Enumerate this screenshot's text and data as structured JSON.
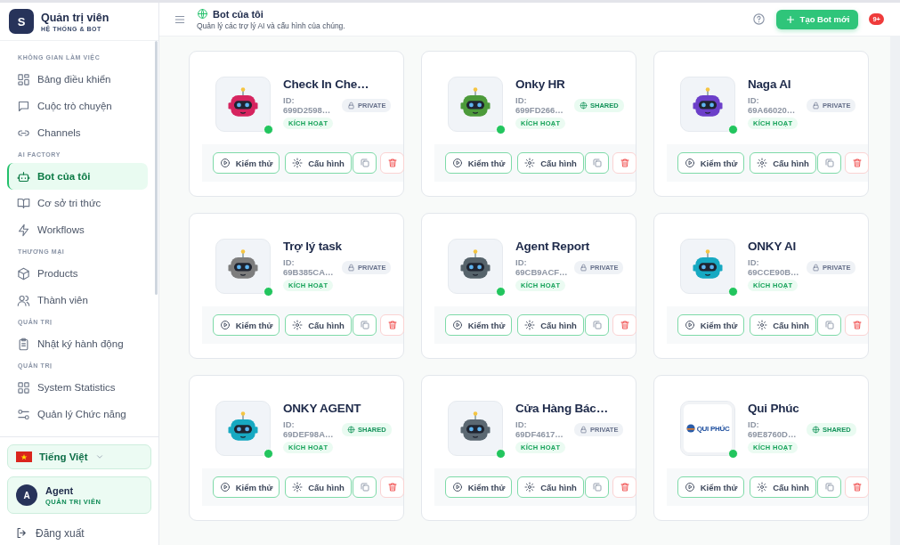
{
  "brand": {
    "logo_letter": "S",
    "title": "Quản trị viên",
    "subtitle": "HỆ THỐNG & BOT"
  },
  "sidebar": {
    "sections": [
      {
        "heading": "KHÔNG GIAN LÀM VIỆC",
        "items": [
          {
            "label": "Bảng điều khiển",
            "selected": false
          },
          {
            "label": "Cuộc trò chuyện",
            "selected": false
          },
          {
            "label": "Channels",
            "selected": false
          }
        ]
      },
      {
        "heading": "AI FACTORY",
        "items": [
          {
            "label": "Bot của tôi",
            "selected": true
          },
          {
            "label": "Cơ sở tri thức",
            "selected": false
          },
          {
            "label": "Workflows",
            "selected": false
          }
        ]
      },
      {
        "heading": "THƯƠNG MẠI",
        "items": [
          {
            "label": "Products",
            "selected": false
          },
          {
            "label": "Thành viên",
            "selected": false
          }
        ]
      },
      {
        "heading": "QUẢN TRỊ",
        "items": [
          {
            "label": "Nhật ký hành động",
            "selected": false
          }
        ]
      },
      {
        "heading": "QUẢN TRỊ",
        "items": [
          {
            "label": "System Statistics",
            "selected": false
          },
          {
            "label": "Quản lý Chức năng",
            "selected": false
          }
        ]
      }
    ],
    "language": "Tiếng Việt",
    "user": {
      "avatar_letter": "A",
      "name": "Agent",
      "role": "QUẢN TRỊ VIÊN"
    },
    "logout": "Đăng xuất"
  },
  "header": {
    "title": "Bot của tôi",
    "subtitle": "Quản lý các trợ lý AI và cấu hình của chúng.",
    "create_button": "Tạo Bot mới",
    "notification_count": "9+"
  },
  "bots": [
    {
      "name": "Check In Che…",
      "id_label": "ID:",
      "id": "699D2598…",
      "visibility": {
        "kind": "private",
        "label": "PRIVATE"
      },
      "status": "KÍCH HOẠT",
      "online": true,
      "avatar": {
        "kind": "robot",
        "color": "#d6245f"
      },
      "test_button": "Kiểm thử",
      "config_button": "Cấu hình"
    },
    {
      "name": "Onky HR",
      "id_label": "ID:",
      "id": "699FD266…",
      "visibility": {
        "kind": "shared",
        "label": "SHARED"
      },
      "status": "KÍCH HOẠT",
      "online": true,
      "avatar": {
        "kind": "robot",
        "color": "#4c9a3a"
      },
      "test_button": "Kiểm thử",
      "config_button": "Cấu hình"
    },
    {
      "name": "Naga AI",
      "id_label": "ID:",
      "id": "69A66020…",
      "visibility": {
        "kind": "private",
        "label": "PRIVATE"
      },
      "status": "KÍCH HOẠT",
      "online": true,
      "avatar": {
        "kind": "robot",
        "color": "#6c3fc9"
      },
      "test_button": "Kiểm thử",
      "config_button": "Cấu hình"
    },
    {
      "name": "Trợ lý task",
      "id_label": "ID:",
      "id": "69B385CA…",
      "visibility": {
        "kind": "private",
        "label": "PRIVATE"
      },
      "status": "KÍCH HOẠT",
      "online": true,
      "avatar": {
        "kind": "robot",
        "color": "#7d7d7d"
      },
      "test_button": "Kiểm thử",
      "config_button": "Cấu hình"
    },
    {
      "name": "Agent Report",
      "id_label": "ID:",
      "id": "69CB9ACF…",
      "visibility": {
        "kind": "private",
        "label": "PRIVATE"
      },
      "status": "KÍCH HOẠT",
      "online": true,
      "avatar": {
        "kind": "robot",
        "color": "#56636b"
      },
      "test_button": "Kiểm thử",
      "config_button": "Cấu hình"
    },
    {
      "name": "ONKY AI",
      "id_label": "ID:",
      "id": "69CCE90B…",
      "visibility": {
        "kind": "private",
        "label": "PRIVATE"
      },
      "status": "KÍCH HOẠT",
      "online": true,
      "avatar": {
        "kind": "robot",
        "color": "#17a9c2"
      },
      "test_button": "Kiểm thử",
      "config_button": "Cấu hình"
    },
    {
      "name": "ONKY AGENT",
      "id_label": "ID:",
      "id": "69DEF98A…",
      "visibility": {
        "kind": "shared",
        "label": "SHARED"
      },
      "status": "KÍCH HOẠT",
      "online": true,
      "avatar": {
        "kind": "robot",
        "color": "#17a9c2"
      },
      "test_button": "Kiểm thử",
      "config_button": "Cấu hình"
    },
    {
      "name": "Cửa Hàng Bác…",
      "id_label": "ID:",
      "id": "69DF4617…",
      "visibility": {
        "kind": "private",
        "label": "PRIVATE"
      },
      "status": "KÍCH HOẠT",
      "online": true,
      "avatar": {
        "kind": "robot",
        "color": "#5b6872"
      },
      "test_button": "Kiểm thử",
      "config_button": "Cấu hình"
    },
    {
      "name": "Qui Phúc",
      "id_label": "ID:",
      "id": "69E8760D…",
      "visibility": {
        "kind": "shared",
        "label": "SHARED"
      },
      "status": "KÍCH HOẠT",
      "online": true,
      "avatar": {
        "kind": "logo",
        "text": "QUI PHÚC"
      },
      "test_button": "Kiểm thử",
      "config_button": "Cấu hình"
    }
  ]
}
